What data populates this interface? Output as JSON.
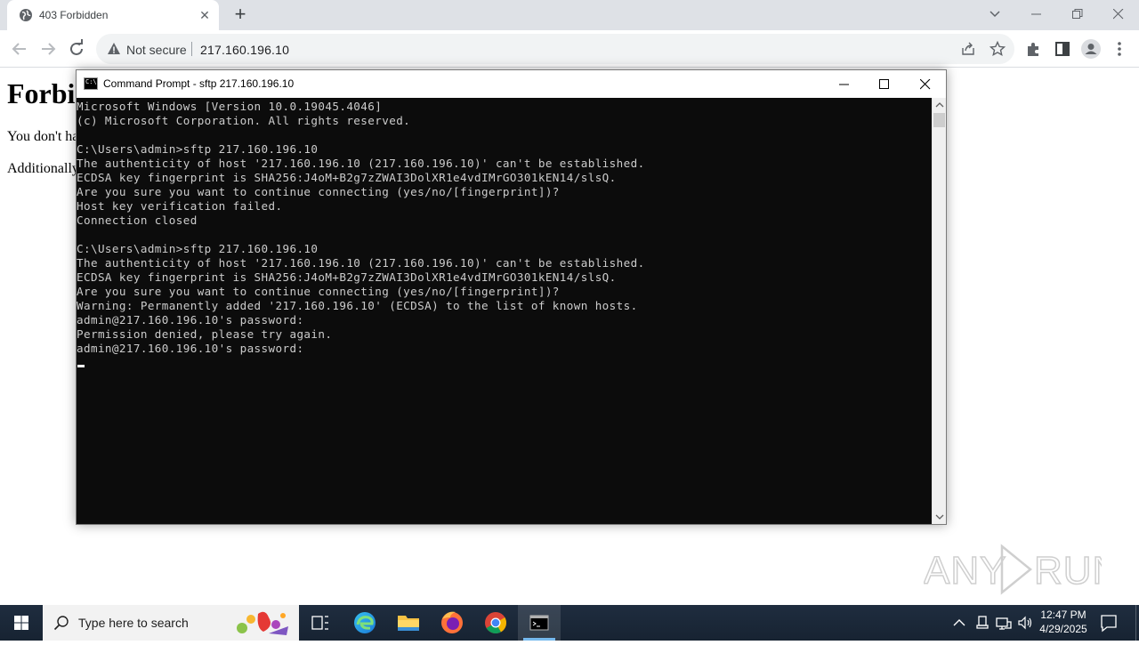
{
  "browser": {
    "tab_title": "403 Forbidden",
    "close_tab_glyph": "✕",
    "new_tab_glyph": "+",
    "security_label": "Not secure",
    "url": "217.160.196.10"
  },
  "page": {
    "heading": "Forbi",
    "line1": "You don't hav",
    "line2": "Additionally,"
  },
  "cmd": {
    "title": "Command Prompt - sftp  217.160.196.10",
    "icon_text": "C:\\",
    "lines": [
      "Microsoft Windows [Version 10.0.19045.4046]",
      "(c) Microsoft Corporation. All rights reserved.",
      "",
      "C:\\Users\\admin>sftp 217.160.196.10",
      "The authenticity of host '217.160.196.10 (217.160.196.10)' can't be established.",
      "ECDSA key fingerprint is SHA256:J4oM+B2g7zZWAI3DolXR1e4vdIMrGO301kEN14/slsQ.",
      "Are you sure you want to continue connecting (yes/no/[fingerprint])?",
      "Host key verification failed.",
      "Connection closed",
      "",
      "C:\\Users\\admin>sftp 217.160.196.10",
      "The authenticity of host '217.160.196.10 (217.160.196.10)' can't be established.",
      "ECDSA key fingerprint is SHA256:J4oM+B2g7zZWAI3DolXR1e4vdIMrGO301kEN14/slsQ.",
      "Are you sure you want to continue connecting (yes/no/[fingerprint])?",
      "Warning: Permanently added '217.160.196.10' (ECDSA) to the list of known hosts.",
      "admin@217.160.196.10's password:",
      "Permission denied, please try again.",
      "admin@217.160.196.10's password:"
    ]
  },
  "watermark": "ANY RUN",
  "taskbar": {
    "search_placeholder": "Type here to search",
    "time": "12:47 PM",
    "date": "4/29/2025"
  },
  "icons": {
    "tab": "globe-icon",
    "toolbar": [
      "back-icon",
      "forward-icon",
      "reload-icon",
      "warning-icon",
      "share-icon",
      "star-icon",
      "extensions-icon",
      "side-panel-icon",
      "profile-icon",
      "menu-icon"
    ],
    "taskbar": [
      "windows-start-icon",
      "search-icon",
      "task-view-icon",
      "edge-icon",
      "file-explorer-icon",
      "firefox-icon",
      "chrome-icon",
      "command-prompt-icon"
    ],
    "tray": [
      "chevron-up-icon",
      "usb-icon",
      "network-icon",
      "volume-icon",
      "notification-icon"
    ]
  },
  "colors": {
    "console_bg": "#0c0c0c",
    "console_text": "#cccccc",
    "taskbar_bg": "#1b2838",
    "tabstrip_bg": "#dee1e6"
  }
}
